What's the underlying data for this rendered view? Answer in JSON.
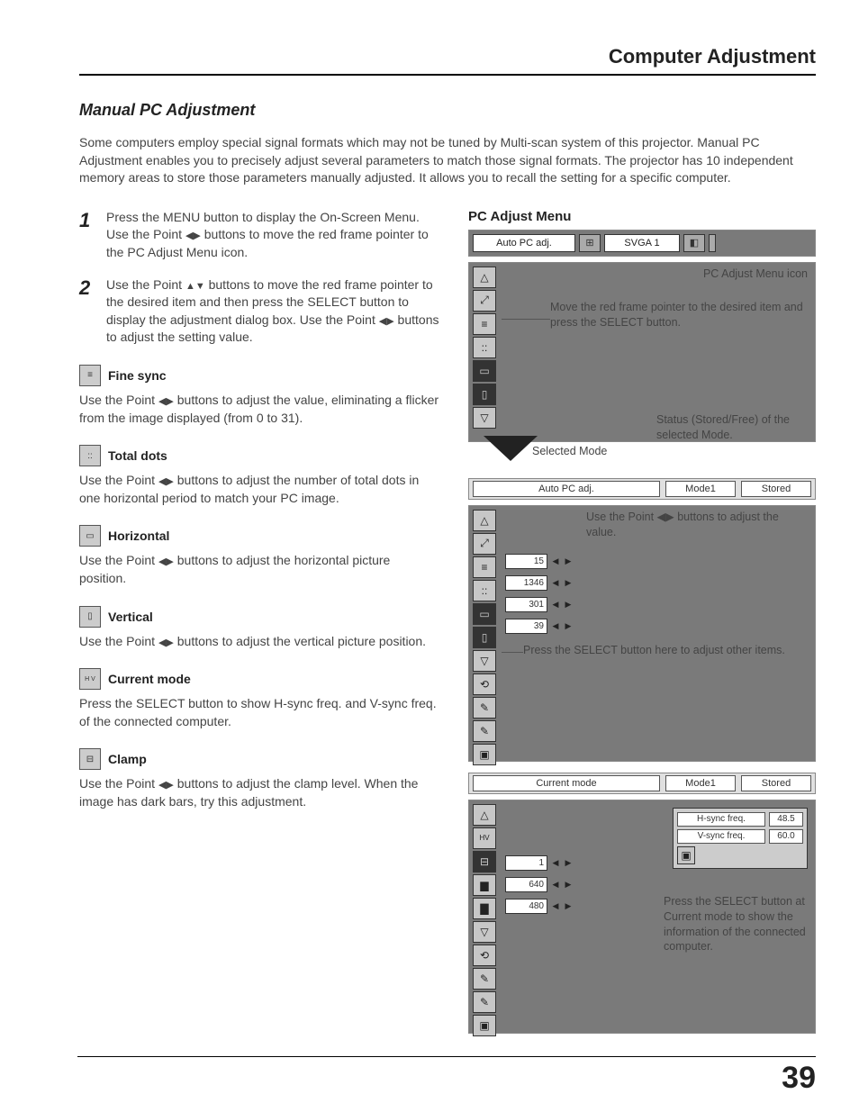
{
  "header": {
    "title": "Computer Adjustment"
  },
  "section": {
    "title": "Manual PC Adjustment"
  },
  "intro": "Some computers employ special signal formats which may not be tuned by Multi-scan system of this projector. Manual PC Adjustment enables you to precisely adjust several parameters to match those signal formats. The projector has 10 independent memory areas to store those parameters manually adjusted. It allows you to recall the setting for a specific computer.",
  "steps": [
    {
      "num": "1",
      "text_a": "Press the MENU button to display the On-Screen Menu. Use the Point ",
      "text_b": " buttons to move the red frame pointer to the PC Adjust Menu icon."
    },
    {
      "num": "2",
      "text_a": "Use the Point ",
      "text_b": " buttons to move the red frame pointer to the desired item and then press the SELECT button to display the adjustment dialog box. Use the Point ",
      "text_c": " buttons to adjust the setting value."
    }
  ],
  "items": [
    {
      "title": "Fine sync",
      "desc_a": "Use the Point ",
      "desc_b": " buttons to adjust the value, eliminating a flicker from the image displayed (from 0 to 31)."
    },
    {
      "title": "Total dots",
      "desc_a": "Use the Point ",
      "desc_b": " buttons to adjust the number of total dots in one horizontal period to match your PC image."
    },
    {
      "title": "Horizontal",
      "desc_a": "Use the Point ",
      "desc_b": " buttons to adjust the horizontal picture position."
    },
    {
      "title": "Vertical",
      "desc_a": "Use the Point ",
      "desc_b": " buttons to adjust the vertical picture position."
    },
    {
      "title": "Current mode",
      "desc_plain": "Press the SELECT button to show H-sync freq. and V-sync freq. of the connected computer."
    },
    {
      "title": "Clamp",
      "desc_a": "Use the Point ",
      "desc_b": " buttons to adjust the clamp level. When the image has dark bars, try this adjustment."
    }
  ],
  "right": {
    "title": "PC Adjust Menu",
    "menubar": {
      "auto": "Auto PC adj.",
      "mode": "SVGA 1"
    },
    "label_icon": "PC Adjust Menu icon",
    "label_move": "Move the red frame pointer to the desired item and press the SELECT button.",
    "label_status": "Status (Stored/Free) of the selected Mode.",
    "label_selected": "Selected Mode",
    "status1": {
      "a": "Auto PC adj.",
      "b": "Mode1",
      "c": "Stored"
    },
    "label_adjust": "Use the Point ◀▶ buttons to adjust the value.",
    "values1": [
      "15",
      "1346",
      "301",
      "39"
    ],
    "label_select_other": "Press the SELECT button here to adjust other items.",
    "status2": {
      "a": "Current mode",
      "b": "Mode1",
      "c": "Stored"
    },
    "info": {
      "h_label": "H-sync freq.",
      "h_val": "48.5",
      "v_label": "V-sync freq.",
      "v_val": "60.0"
    },
    "values2": [
      "1",
      "640",
      "480"
    ],
    "label_current": "Press the SELECT button at Current mode to show the information of the connected computer."
  },
  "page_number": "39"
}
